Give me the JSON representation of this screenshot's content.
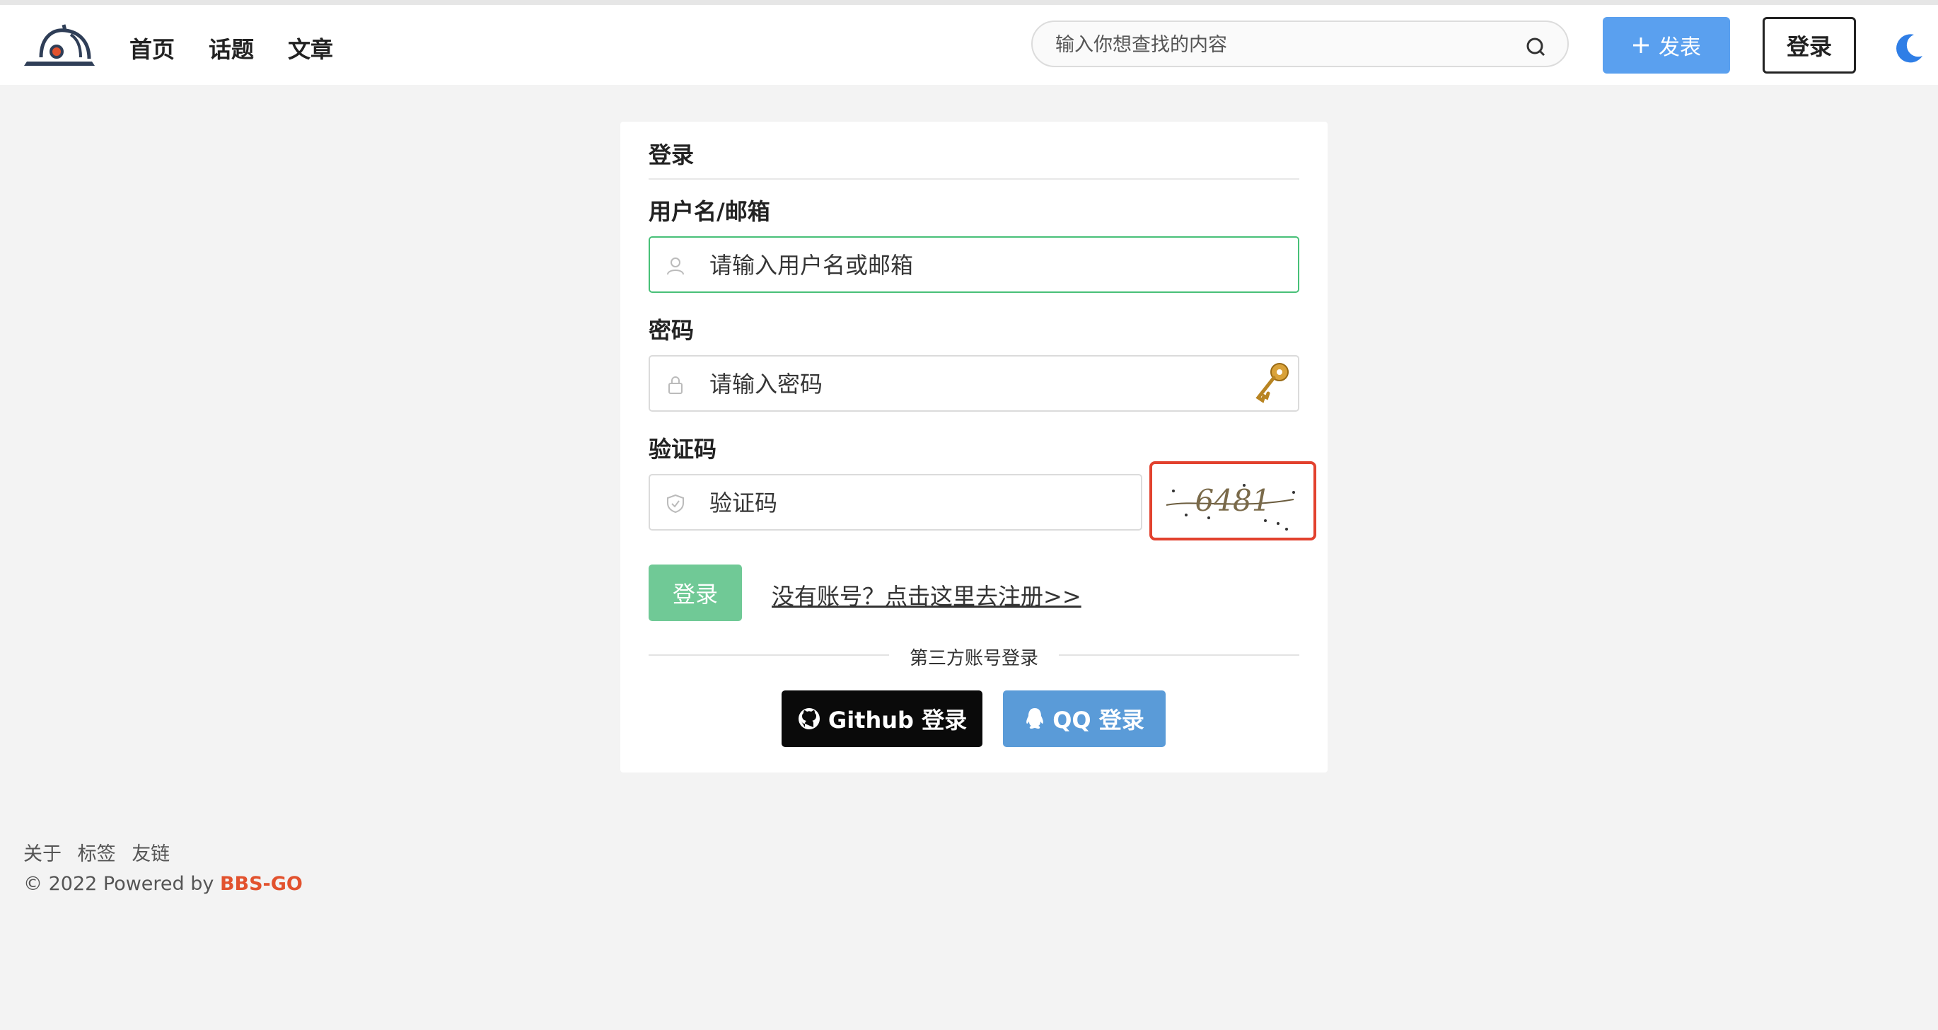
{
  "nav": {
    "items": [
      {
        "label": "首页"
      },
      {
        "label": "话题"
      },
      {
        "label": "文章"
      }
    ]
  },
  "search": {
    "placeholder": "输入你想查找的内容"
  },
  "header": {
    "post_label": "发表",
    "login_label": "登录"
  },
  "login_form": {
    "title": "登录",
    "username_label": "用户名/邮箱",
    "username_placeholder": "请输入用户名或邮箱",
    "password_label": "密码",
    "password_placeholder": "请输入密码",
    "captcha_label": "验证码",
    "captcha_placeholder": "验证码",
    "captcha_text": "6481",
    "submit_label": "登录",
    "register_link": "没有账号？点击这里去注册>>",
    "third_party_label": "第三方账号登录",
    "github_label": "Github 登录",
    "qq_label": "QQ 登录"
  },
  "footer": {
    "links": [
      {
        "label": "关于"
      },
      {
        "label": "标签"
      },
      {
        "label": "友链"
      }
    ],
    "copyright_prefix": "© 2022 Powered by ",
    "brand": "BBS-GO"
  },
  "colors": {
    "accent_blue": "#5aa0ef",
    "success_green": "#70c996",
    "github_black": "#0a0a0a",
    "qq_blue": "#5a9bd8",
    "brand_orange": "#e2522e",
    "captcha_highlight": "#e2412e"
  }
}
